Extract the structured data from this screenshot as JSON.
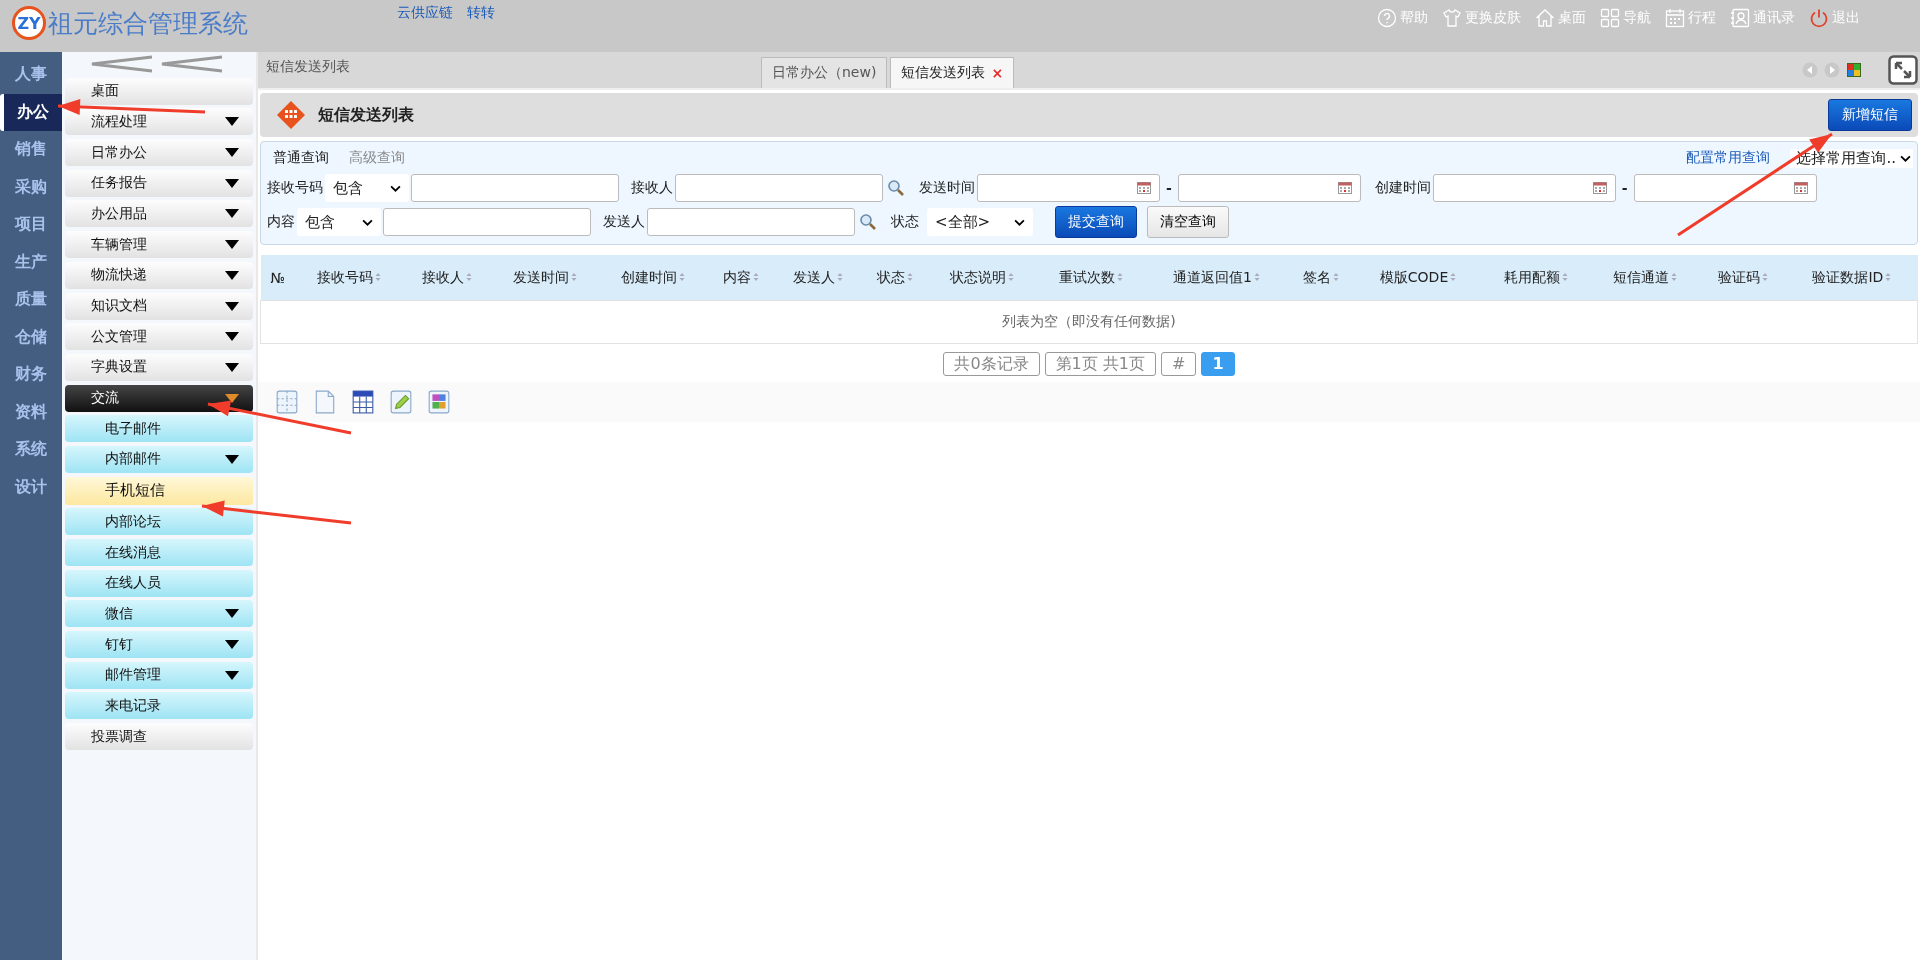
{
  "app": {
    "logo": "ZY",
    "title": "祖元综合管理系统",
    "links": [
      "云供应链",
      "转转"
    ]
  },
  "toolbar": [
    {
      "kind": "help",
      "label": "帮助"
    },
    {
      "kind": "skin",
      "label": "更换皮肤"
    },
    {
      "kind": "home",
      "label": "桌面"
    },
    {
      "kind": "nav",
      "label": "导航"
    },
    {
      "kind": "calendar",
      "label": "行程"
    },
    {
      "kind": "contacts",
      "label": "通讯录"
    },
    {
      "kind": "logout",
      "label": "退出"
    }
  ],
  "modules": [
    {
      "label": "人事",
      "selected": false
    },
    {
      "label": "办公",
      "selected": true
    },
    {
      "label": "销售",
      "selected": false
    },
    {
      "label": "采购",
      "selected": false
    },
    {
      "label": "项目",
      "selected": false
    },
    {
      "label": "生产",
      "selected": false
    },
    {
      "label": "质量",
      "selected": false
    },
    {
      "label": "仓储",
      "selected": false
    },
    {
      "label": "财务",
      "selected": false
    },
    {
      "label": "资料",
      "selected": false
    },
    {
      "label": "系统",
      "selected": false
    },
    {
      "label": "设计",
      "selected": false
    }
  ],
  "menu": [
    {
      "label": "桌面",
      "has_submenu": false,
      "expanded": false
    },
    {
      "label": "流程处理",
      "has_submenu": true,
      "expanded": false
    },
    {
      "label": "日常办公",
      "has_submenu": true,
      "expanded": false
    },
    {
      "label": "任务报告",
      "has_submenu": true,
      "expanded": false
    },
    {
      "label": "办公用品",
      "has_submenu": true,
      "expanded": false
    },
    {
      "label": "车辆管理",
      "has_submenu": true,
      "expanded": false
    },
    {
      "label": "物流快递",
      "has_submenu": true,
      "expanded": false
    },
    {
      "label": "知识文档",
      "has_submenu": true,
      "expanded": false
    },
    {
      "label": "公文管理",
      "has_submenu": true,
      "expanded": false
    },
    {
      "label": "字典设置",
      "has_submenu": true,
      "expanded": false
    },
    {
      "label": "交流",
      "has_submenu": true,
      "expanded": true,
      "children": [
        {
          "label": "电子邮件",
          "has_submenu": false,
          "selected": false
        },
        {
          "label": "内部邮件",
          "has_submenu": true,
          "selected": false
        },
        {
          "label": "手机短信",
          "has_submenu": false,
          "selected": true
        },
        {
          "label": "内部论坛",
          "has_submenu": false,
          "selected": false
        },
        {
          "label": "在线消息",
          "has_submenu": false,
          "selected": false
        },
        {
          "label": "在线人员",
          "has_submenu": false,
          "selected": false
        },
        {
          "label": "微信",
          "has_submenu": true,
          "selected": false
        },
        {
          "label": "钉钉",
          "has_submenu": true,
          "selected": false
        },
        {
          "label": "邮件管理",
          "has_submenu": true,
          "selected": false
        },
        {
          "label": "来电记录",
          "has_submenu": false,
          "selected": false
        }
      ]
    },
    {
      "label": "投票调查",
      "has_submenu": false,
      "expanded": false
    }
  ],
  "breadcrumb": "短信发送列表",
  "tabs": [
    {
      "label": "日常办公（new)",
      "selected": false
    },
    {
      "label": "短信发送列表",
      "selected": true,
      "close": "×"
    }
  ],
  "page": {
    "title": "短信发送列表",
    "add_button": "新增短信"
  },
  "query": {
    "modes": [
      {
        "label": "普通查询",
        "selected": true
      },
      {
        "label": "高级查询",
        "selected": false
      }
    ],
    "config_link": "配置常用查询",
    "saved_select": "选择常用查询..",
    "rows": [
      [
        {
          "kind": "match",
          "label": "接收号码",
          "operator": "包含"
        },
        {
          "kind": "lookup",
          "label": "接收人"
        },
        {
          "kind": "date_range",
          "label": "发送时间",
          "separator": "-"
        },
        {
          "kind": "date_range",
          "label": "创建时间",
          "separator": "-"
        }
      ],
      [
        {
          "kind": "match",
          "label": "内容",
          "operator": "包含"
        },
        {
          "kind": "lookup",
          "label": "发送人"
        },
        {
          "kind": "select",
          "label": "状态",
          "value": "<全部>"
        }
      ]
    ],
    "submit": "提交查询",
    "clear": "清空查询"
  },
  "table": {
    "columns": [
      {
        "label": "№",
        "sortable": false
      },
      {
        "label": "接收号码",
        "sortable": true
      },
      {
        "label": "接收人",
        "sortable": true
      },
      {
        "label": "发送时间",
        "sortable": true
      },
      {
        "label": "创建时间",
        "sortable": true
      },
      {
        "label": "内容",
        "sortable": true
      },
      {
        "label": "发送人",
        "sortable": true
      },
      {
        "label": "状态",
        "sortable": true
      },
      {
        "label": "状态说明",
        "sortable": true
      },
      {
        "label": "重试次数",
        "sortable": true
      },
      {
        "label": "通道返回值1",
        "sortable": true
      },
      {
        "label": "签名",
        "sortable": true
      },
      {
        "label": "模版CODE",
        "sortable": true
      },
      {
        "label": "耗用配额",
        "sortable": true
      },
      {
        "label": "短信通道",
        "sortable": true
      },
      {
        "label": "验证码",
        "sortable": true
      },
      {
        "label": "验证数据ID",
        "sortable": true
      }
    ],
    "empty_text": "列表为空（即没有任何数据)"
  },
  "pager": {
    "total": "共0条记录",
    "page_info": "第1页 共1页",
    "jump": "#",
    "pages": [
      {
        "label": "1",
        "selected": true
      }
    ]
  }
}
